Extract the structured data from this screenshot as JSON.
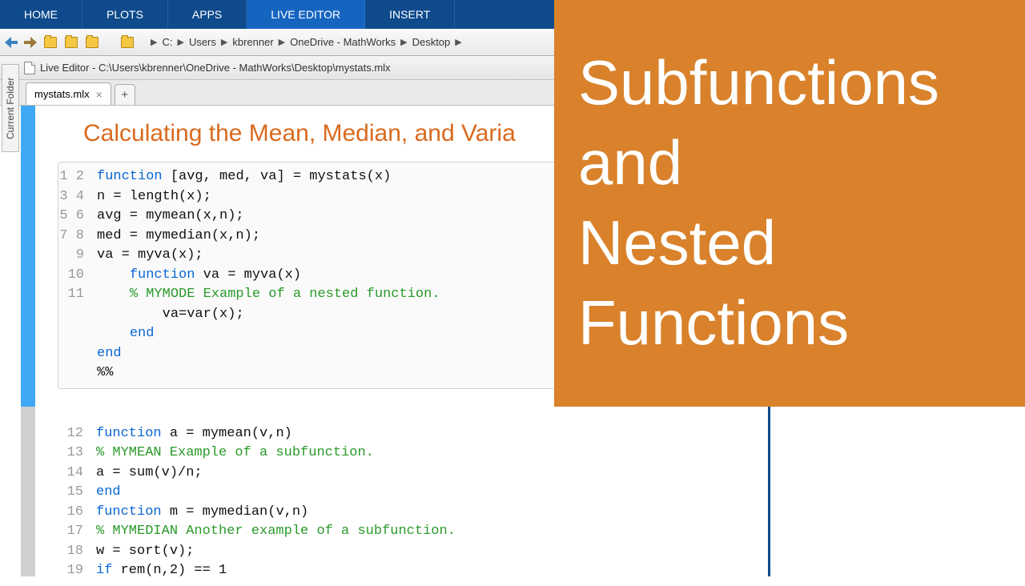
{
  "tabs": {
    "home": "HOME",
    "plots": "PLOTS",
    "apps": "APPS",
    "live": "LIVE EDITOR",
    "insert": "INSERT"
  },
  "breadcrumb": [
    "C:",
    "Users",
    "kbrenner",
    "OneDrive - MathWorks",
    "Desktop"
  ],
  "editorTitle": "Live Editor - C:\\Users\\kbrenner\\OneDrive - MathWorks\\Desktop\\mystats.mlx",
  "sideLabel": "Current Folder",
  "fileTab": "mystats.mlx",
  "docTitle": "Calculating the Mean, Median, and Varia",
  "overlay": {
    "l1": "Subfunctions",
    "l2": "and",
    "l3": "Nested",
    "l4": "Functions"
  },
  "code1": {
    "nums": [
      "1",
      "2",
      "3",
      "4",
      "5",
      "6",
      "7",
      "8",
      "9",
      "10",
      "11"
    ],
    "lines": [
      {
        "indent": 0,
        "seg": [
          {
            "c": "kw",
            "t": "function"
          },
          {
            "c": "txt",
            "t": " [avg, med, va] = mystats(x)"
          }
        ]
      },
      {
        "indent": 0,
        "seg": [
          {
            "c": "txt",
            "t": "n = length(x);"
          }
        ]
      },
      {
        "indent": 0,
        "seg": [
          {
            "c": "txt",
            "t": "avg = mymean(x,n);"
          }
        ]
      },
      {
        "indent": 0,
        "seg": [
          {
            "c": "txt",
            "t": "med = mymedian(x,n);"
          }
        ]
      },
      {
        "indent": 0,
        "seg": [
          {
            "c": "txt",
            "t": "va = myva(x);"
          }
        ]
      },
      {
        "indent": 1,
        "seg": [
          {
            "c": "kw",
            "t": "function"
          },
          {
            "c": "txt",
            "t": " va = myva(x)"
          }
        ]
      },
      {
        "indent": 1,
        "seg": [
          {
            "c": "cm",
            "t": "% MYMODE Example of a nested function."
          }
        ]
      },
      {
        "indent": 2,
        "seg": [
          {
            "c": "txt",
            "t": "va=var(x);"
          }
        ]
      },
      {
        "indent": 1,
        "seg": [
          {
            "c": "kw",
            "t": "end"
          }
        ]
      },
      {
        "indent": 0,
        "seg": [
          {
            "c": "kw",
            "t": "end"
          }
        ]
      },
      {
        "indent": 0,
        "seg": [
          {
            "c": "txt",
            "t": "%%"
          }
        ]
      }
    ]
  },
  "code2": {
    "nums": [
      "12",
      "13",
      "14",
      "15",
      "16",
      "17",
      "18",
      "19"
    ],
    "lines": [
      {
        "indent": 0,
        "seg": [
          {
            "c": "kw",
            "t": "function"
          },
          {
            "c": "txt",
            "t": " a = mymean(v,n)"
          }
        ]
      },
      {
        "indent": 0,
        "seg": [
          {
            "c": "cm",
            "t": "% MYMEAN Example of a subfunction."
          }
        ]
      },
      {
        "indent": 0,
        "seg": [
          {
            "c": "txt",
            "t": "a = sum(v)/n;"
          }
        ]
      },
      {
        "indent": 0,
        "seg": [
          {
            "c": "kw",
            "t": "end"
          }
        ]
      },
      {
        "indent": 0,
        "seg": [
          {
            "c": "kw",
            "t": "function"
          },
          {
            "c": "txt",
            "t": " m = mymedian(v,n)"
          }
        ]
      },
      {
        "indent": 0,
        "seg": [
          {
            "c": "cm",
            "t": "% MYMEDIAN Another example of a subfunction."
          }
        ]
      },
      {
        "indent": 0,
        "seg": [
          {
            "c": "txt",
            "t": "w = sort(v);"
          }
        ]
      },
      {
        "indent": 0,
        "seg": [
          {
            "c": "kw",
            "t": "if"
          },
          {
            "c": "txt",
            "t": " rem(n,2) == 1"
          }
        ]
      }
    ]
  }
}
